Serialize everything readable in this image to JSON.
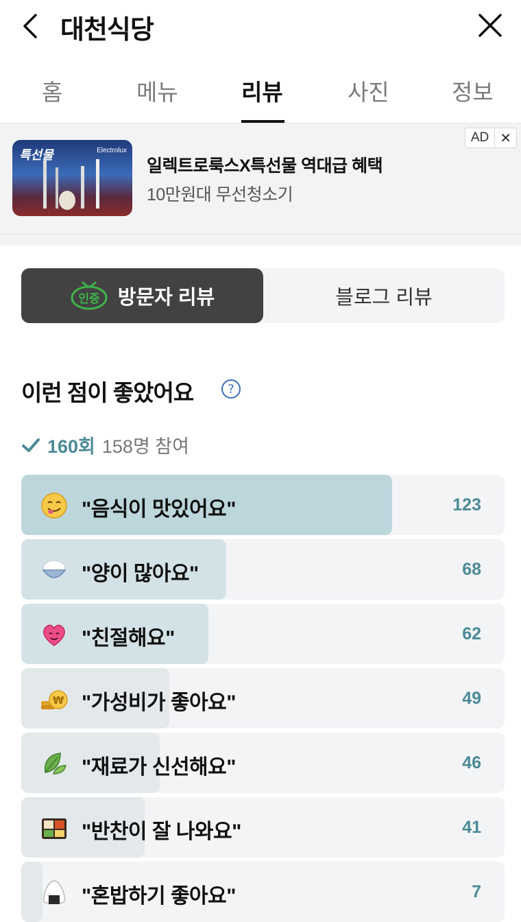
{
  "header": {
    "title": "대천식당"
  },
  "tabs": [
    {
      "label": "홈",
      "active": false
    },
    {
      "label": "메뉴",
      "active": false
    },
    {
      "label": "리뷰",
      "active": true
    },
    {
      "label": "사진",
      "active": false
    },
    {
      "label": "정보",
      "active": false
    }
  ],
  "ad": {
    "badge": "AD",
    "close": "✕",
    "headline": "일렉트로룩스X특선물 역대급 혜택",
    "subline": "10만원대 무선청소기",
    "thumb_text": "특선물",
    "thumb_brand": "Electrolux"
  },
  "segment": {
    "active_label": "방문자 리뷰",
    "badge": "인증",
    "inactive_label": "블로그 리뷰"
  },
  "section": {
    "heading": "이런 점이 좋았어요",
    "count": "160회",
    "participants": "158명 참여"
  },
  "keywords": [
    {
      "label": "\"음식이 맛있어요\"",
      "count": "123",
      "value": 123,
      "icon": "yum-face-icon"
    },
    {
      "label": "\"양이 많아요\"",
      "count": "68",
      "value": 68,
      "icon": "rice-bowl-icon"
    },
    {
      "label": "\"친절해요\"",
      "count": "62",
      "value": 62,
      "icon": "heart-face-icon"
    },
    {
      "label": "\"가성비가 좋아요\"",
      "count": "49",
      "value": 49,
      "icon": "coin-icon"
    },
    {
      "label": "\"재료가 신선해요\"",
      "count": "46",
      "value": 46,
      "icon": "leaf-icon"
    },
    {
      "label": "\"반찬이 잘 나와요\"",
      "count": "41",
      "value": 41,
      "icon": "bento-icon"
    },
    {
      "label": "\"혼밥하기 좋아요\"",
      "count": "7",
      "value": 7,
      "icon": "rice-ball-icon"
    }
  ],
  "colors": {
    "accent": "#4c8a96",
    "bar_top": "#bcd6dc",
    "bar_mid": "#d3e2e6",
    "bar_low": "#e3e8eb",
    "bar_bg": "#f3f4f6",
    "badge_green": "#3fb24a"
  }
}
